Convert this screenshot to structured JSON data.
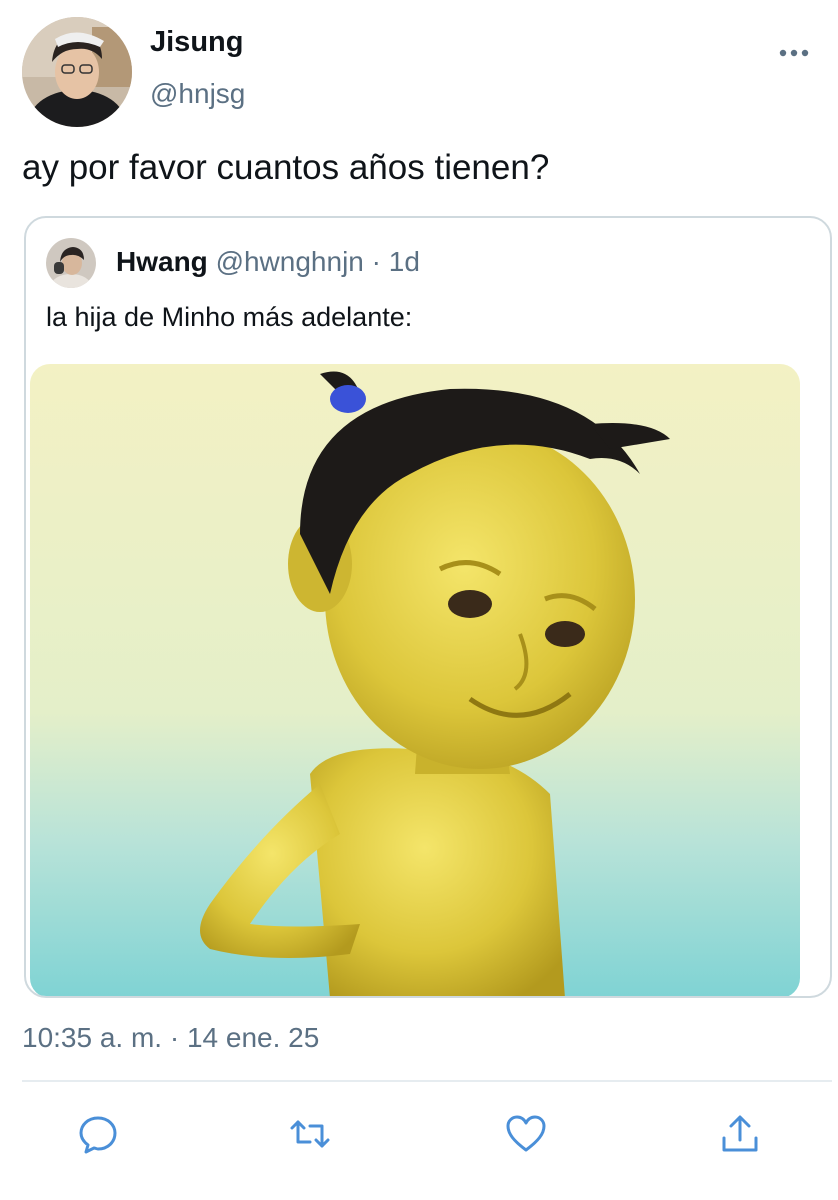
{
  "tweet": {
    "author_name": "Jisung",
    "author_handle": "@hnjsg",
    "text": "ay por favor cuantos años tienen?",
    "timestamp": "10:35 a. m. · 14 ene. 25"
  },
  "quoted_tweet": {
    "author_name": "Hwang",
    "author_handle": "@hwnghnjn",
    "separator": "·",
    "age": "1d",
    "text": "la hija de Minho más adelante:"
  },
  "actions": {
    "icons": [
      "reply-icon",
      "retweet-icon",
      "like-icon",
      "share-icon"
    ]
  },
  "colors": {
    "text_primary": "#0f1419",
    "text_secondary": "#5b7083",
    "border": "#cfd9de",
    "divider": "#e6ecf0"
  }
}
